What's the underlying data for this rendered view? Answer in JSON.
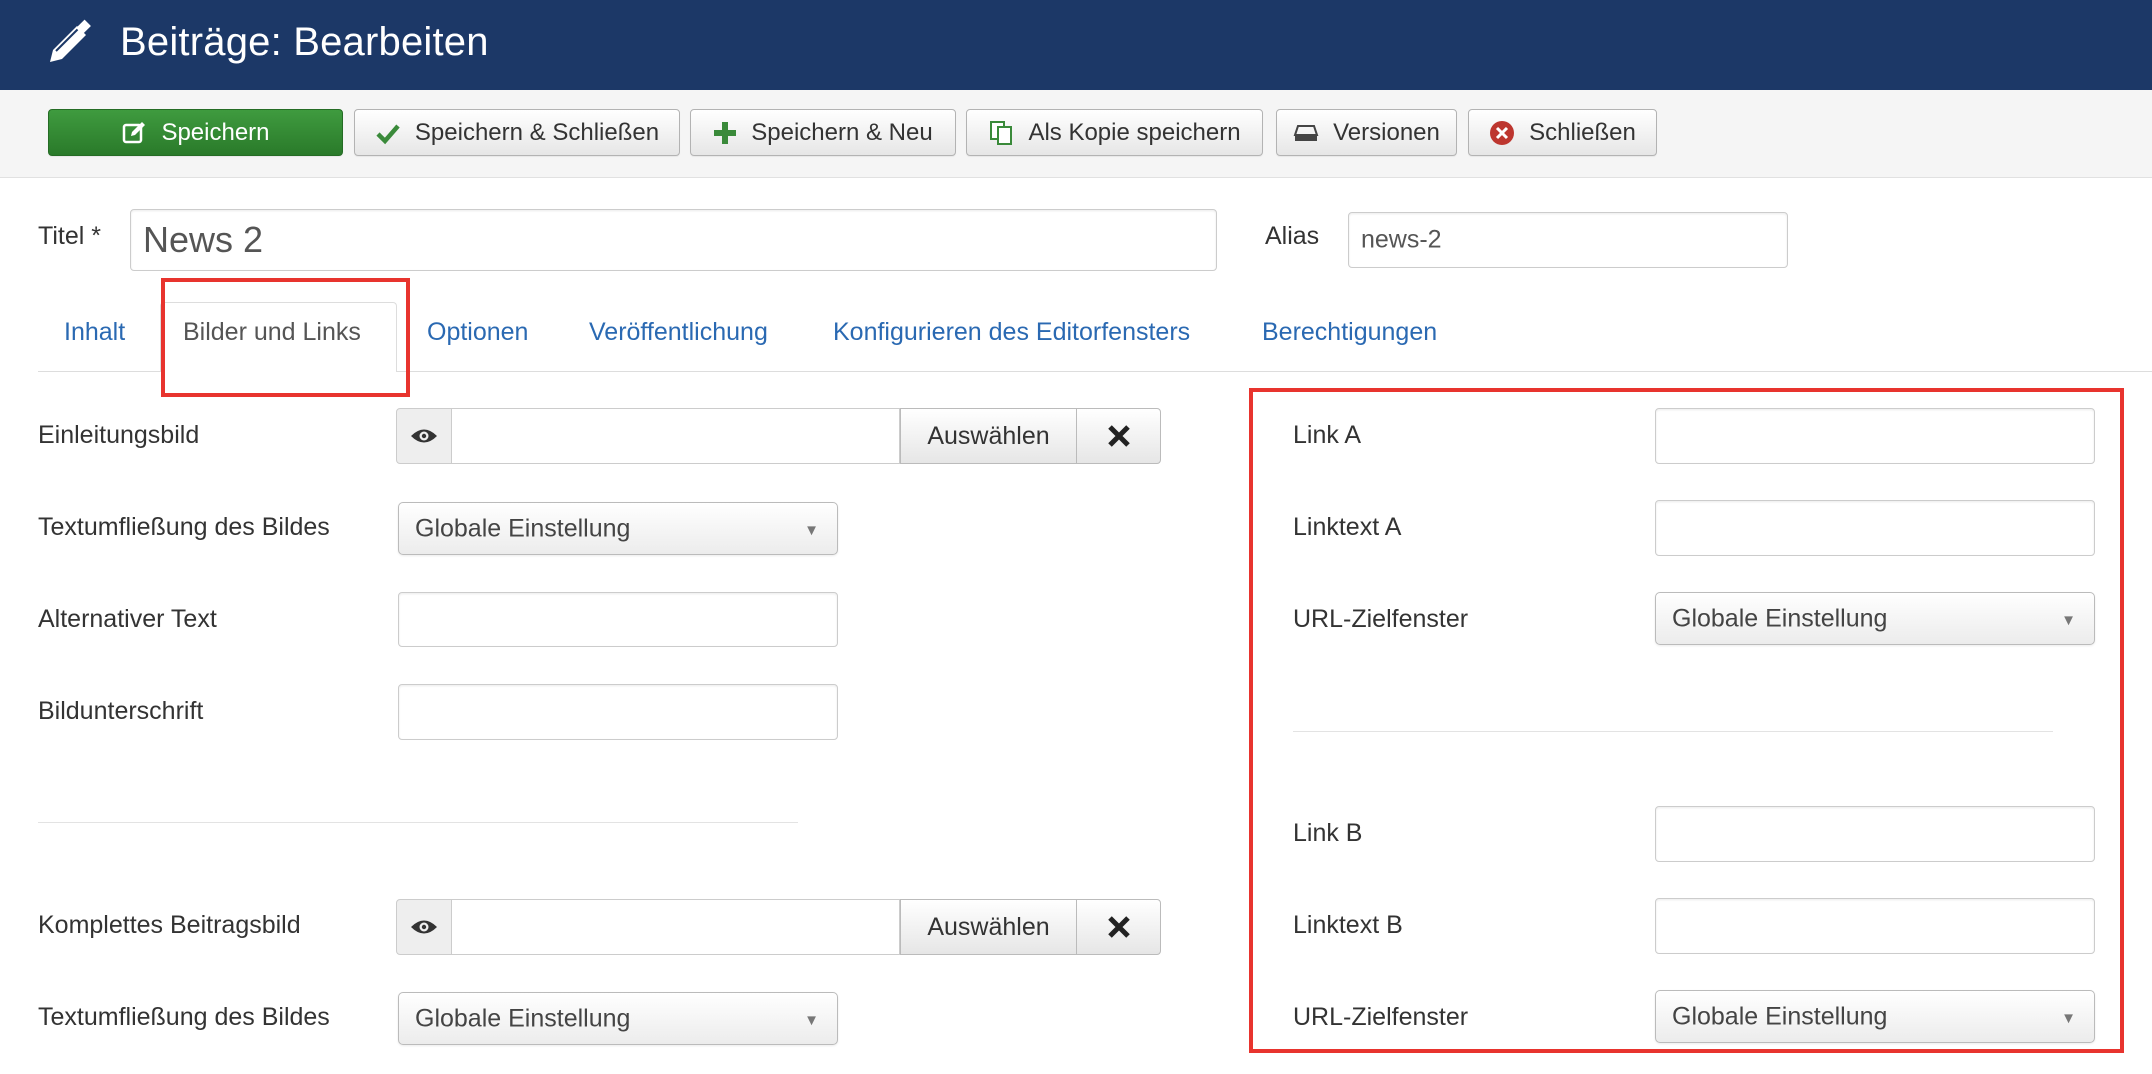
{
  "header": {
    "title": "Beiträge: Bearbeiten",
    "icon": "pencil-icon"
  },
  "toolbar": {
    "save": "Speichern",
    "save_close": "Speichern & Schließen",
    "save_new": "Speichern & Neu",
    "save_copy": "Als Kopie speichern",
    "versions": "Versionen",
    "close": "Schließen"
  },
  "form": {
    "title_label": "Titel *",
    "title_value": "News 2",
    "alias_label": "Alias",
    "alias_value": "news-2"
  },
  "tabs": [
    "Inhalt",
    "Bilder und Links",
    "Optionen",
    "Veröffentlichung",
    "Konfigurieren des Editorfensters",
    "Berechtigungen"
  ],
  "images": {
    "intro_label": "Einleitungsbild",
    "choose": "Auswählen",
    "float_label": "Textumfließung des Bildes",
    "global_setting": "Globale Einstellung",
    "alt_label": "Alternativer Text",
    "caption_label": "Bildunterschrift",
    "full_label": "Komplettes Beitragsbild",
    "float_label_2": "Textumfließung des Bildes"
  },
  "links": {
    "link_a": "Link A",
    "linktext_a": "Linktext A",
    "target_a": "URL-Zielfenster",
    "link_b": "Link B",
    "linktext_b": "Linktext B",
    "target_b": "URL-Zielfenster",
    "global_setting": "Globale Einstellung"
  },
  "colors": {
    "header": "#1c3867",
    "primary": "#2a7a2a",
    "tab_link": "#2a69b2",
    "highlight": "#e8342e"
  }
}
